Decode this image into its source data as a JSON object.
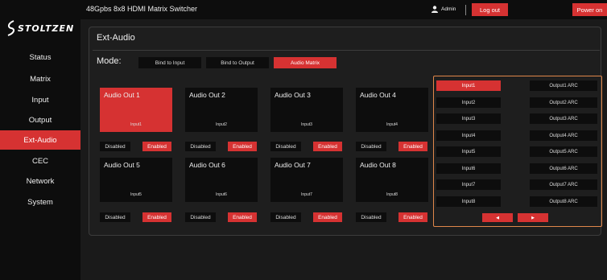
{
  "brand": {
    "logo_text": "STOLTZEN"
  },
  "sidebar": {
    "items": [
      {
        "label": "Status",
        "active": false
      },
      {
        "label": "Matrix",
        "active": false
      },
      {
        "label": "Input",
        "active": false
      },
      {
        "label": "Output",
        "active": false
      },
      {
        "label": "Ext-Audio",
        "active": true
      },
      {
        "label": "CEC",
        "active": false
      },
      {
        "label": "Network",
        "active": false
      },
      {
        "label": "System",
        "active": false
      }
    ]
  },
  "header": {
    "title": "48Gpbs 8x8 HDMI Matrix Switcher",
    "user_icon": "user-icon",
    "user": "Admin",
    "logout_label": "Log out",
    "power_label": "Power on"
  },
  "panel": {
    "title": "Ext-Audio",
    "mode_label": "Mode:",
    "modes": [
      {
        "label": "Bind to Input",
        "active": false
      },
      {
        "label": "Bind to Output",
        "active": false
      },
      {
        "label": "Audio Matrix",
        "active": true
      }
    ]
  },
  "audio_outputs": [
    {
      "title": "Audio Out 1",
      "input": "Input1",
      "selected": true,
      "disabled_label": "Disabled",
      "enabled_label": "Enabled"
    },
    {
      "title": "Audio Out 2",
      "input": "Input2",
      "selected": false,
      "disabled_label": "Disabled",
      "enabled_label": "Enabled"
    },
    {
      "title": "Audio Out 3",
      "input": "Input3",
      "selected": false,
      "disabled_label": "Disabled",
      "enabled_label": "Enabled"
    },
    {
      "title": "Audio Out 4",
      "input": "Input4",
      "selected": false,
      "disabled_label": "Disabled",
      "enabled_label": "Enabled"
    },
    {
      "title": "Audio Out 5",
      "input": "Input5",
      "selected": false,
      "disabled_label": "Disabled",
      "enabled_label": "Enabled"
    },
    {
      "title": "Audio Out 6",
      "input": "Input6",
      "selected": false,
      "disabled_label": "Disabled",
      "enabled_label": "Enabled"
    },
    {
      "title": "Audio Out 7",
      "input": "Input7",
      "selected": false,
      "disabled_label": "Disabled",
      "enabled_label": "Enabled"
    },
    {
      "title": "Audio Out 8",
      "input": "Input8",
      "selected": false,
      "disabled_label": "Disabled",
      "enabled_label": "Enabled"
    }
  ],
  "sources": {
    "inputs": [
      {
        "label": "Input1",
        "selected": true
      },
      {
        "label": "Input2",
        "selected": false
      },
      {
        "label": "Input3",
        "selected": false
      },
      {
        "label": "Input4",
        "selected": false
      },
      {
        "label": "Input5",
        "selected": false
      },
      {
        "label": "Input6",
        "selected": false
      },
      {
        "label": "Input7",
        "selected": false
      },
      {
        "label": "Input8",
        "selected": false
      }
    ],
    "arc_outputs": [
      "Output1 ARC",
      "Output2 ARC",
      "Output3 ARC",
      "Output4 ARC",
      "Output5 ARC",
      "Output6 ARC",
      "Output7 ARC",
      "Output8 ARC"
    ],
    "prev_icon": "triangle-left-icon",
    "next_icon": "triangle-right-icon",
    "prev_glyph": "◀",
    "next_glyph": "▶"
  },
  "colors": {
    "accent": "#d63232",
    "panel_highlight": "#e0874a",
    "background": "#1a1a1a",
    "dark": "#0d0d0d"
  }
}
